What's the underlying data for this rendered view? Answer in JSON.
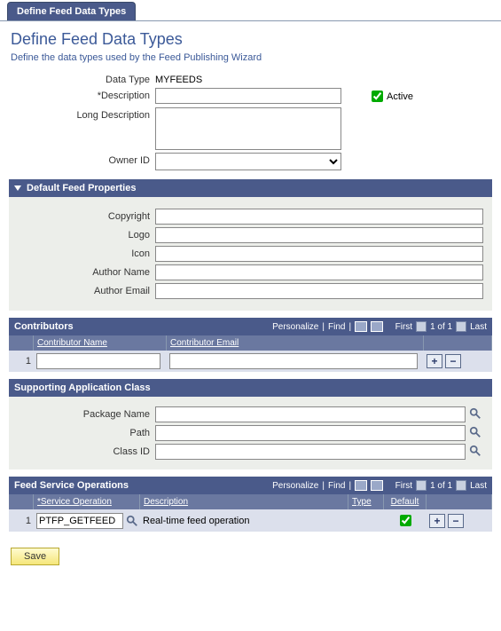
{
  "tab": {
    "label": "Define Feed Data Types"
  },
  "page": {
    "title": "Define Feed Data Types",
    "subtitle": "Define the data types used by the Feed Publishing Wizard"
  },
  "fields": {
    "data_type_label": "Data Type",
    "data_type_value": "MYFEEDS",
    "description_label": "*Description",
    "description_value": "",
    "active_label": "Active",
    "long_description_label": "Long Description",
    "long_description_value": "",
    "owner_id_label": "Owner ID",
    "owner_id_value": ""
  },
  "default_feed_properties": {
    "title": "Default Feed Properties",
    "copyright_label": "Copyright",
    "copyright_value": "",
    "logo_label": "Logo",
    "logo_value": "",
    "icon_label": "Icon",
    "icon_value": "",
    "author_name_label": "Author Name",
    "author_name_value": "",
    "author_email_label": "Author Email",
    "author_email_value": ""
  },
  "contributors": {
    "title": "Contributors",
    "tools": {
      "personalize": "Personalize",
      "find": "Find",
      "first": "First",
      "count": "1 of 1",
      "last": "Last"
    },
    "columns": {
      "name": "Contributor Name",
      "email": "Contributor Email"
    },
    "rows": [
      {
        "num": "1",
        "name": "",
        "email": ""
      }
    ]
  },
  "supporting_app_class": {
    "title": "Supporting Application Class",
    "package_name_label": "Package Name",
    "package_name_value": "",
    "path_label": "Path",
    "path_value": "",
    "class_id_label": "Class ID",
    "class_id_value": ""
  },
  "feed_service_ops": {
    "title": "Feed Service Operations",
    "tools": {
      "personalize": "Personalize",
      "find": "Find",
      "first": "First",
      "count": "1 of 1",
      "last": "Last"
    },
    "columns": {
      "svc": "*Service Operation",
      "desc": "Description",
      "type": "Type",
      "def": "Default"
    },
    "rows": [
      {
        "num": "1",
        "svc": "PTFP_GETFEED",
        "desc": "Real-time feed operation",
        "type": "",
        "def_checked": true
      }
    ]
  },
  "buttons": {
    "save": "Save"
  }
}
